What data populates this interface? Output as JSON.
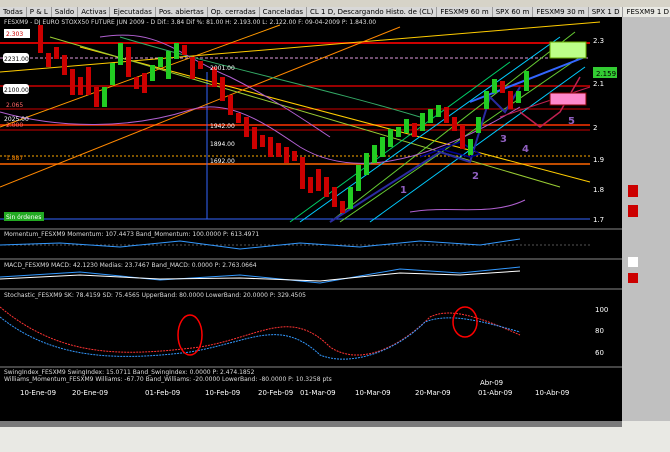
{
  "tabs": [
    "Todas",
    "P & L",
    "Saldo",
    "Activas",
    "Ejecutadas",
    "Pos. abiertas",
    "Op. cerradas",
    "Canceladas",
    "CL 1 D, Descargando Histo. de (CL)",
    "FESXM9 60 m",
    "SPX 60 m",
    "FESXM9 30 m",
    "SPX 1 D",
    "FESXM9 1 D"
  ],
  "header": {
    "text": "FESXM9 - DJ EURO STOXX50 FUTURE JUN 2009 - D  Dif.: 3.84  Dif %: 81.00  H: 2.193.00  L: 2.122.00  F: 09-04-2009  P: 1.843.00"
  },
  "bottom_line": {
    "text": "Williams_Momentum_FESXM9 Williams: -67.70  Band_Williams: -20.0000  LowerBand: -80.0000  P: 10.3258 pts"
  },
  "chart_data": {
    "type": "candlestick",
    "symbol": "FESXM9",
    "dates": [
      "10-Ene-09",
      "20-Ene-09",
      "01-Feb-09",
      "10-Feb-09",
      "20-Feb-09",
      "01-Mar-09",
      "10-Mar-09",
      "20-Mar-09",
      "Abr-09",
      "01-Abr-09",
      "10-Abr-09"
    ],
    "yaxis": [
      2.3,
      2.2,
      2.1,
      2.0,
      1.9,
      1.8,
      1.7
    ],
    "price_labels": [
      "2.303",
      "2231.00",
      "2100.00",
      "2025.00",
      "2001.00",
      "1942.00",
      "1894.00",
      "1692.00",
      "2.065",
      "2.000",
      "1.887",
      "2.159"
    ],
    "wave_labels": [
      "1",
      "2",
      "3",
      "4",
      "5"
    ],
    "indicators": [
      {
        "name": "Momentum_FESXM9 Momentum",
        "value": "107.4473",
        "band": "100.0000",
        "p": "613.4971"
      },
      {
        "name": "MACD_FESXM9 MACD",
        "value": "42.1230",
        "band": "23.7467",
        "p": "2.763.0664"
      },
      {
        "name": "Stochastic_FESXM9 SK",
        "value": "78.4159",
        "band": "75.4565  UpperBand: 80.0000  LowerBand: 20.0000",
        "p": "329.4505"
      },
      {
        "name": "SwingIndex_FESXM9 SwingIndex",
        "value": "15.0711",
        "band": "0.0000",
        "p": "2.474.1852"
      }
    ]
  }
}
